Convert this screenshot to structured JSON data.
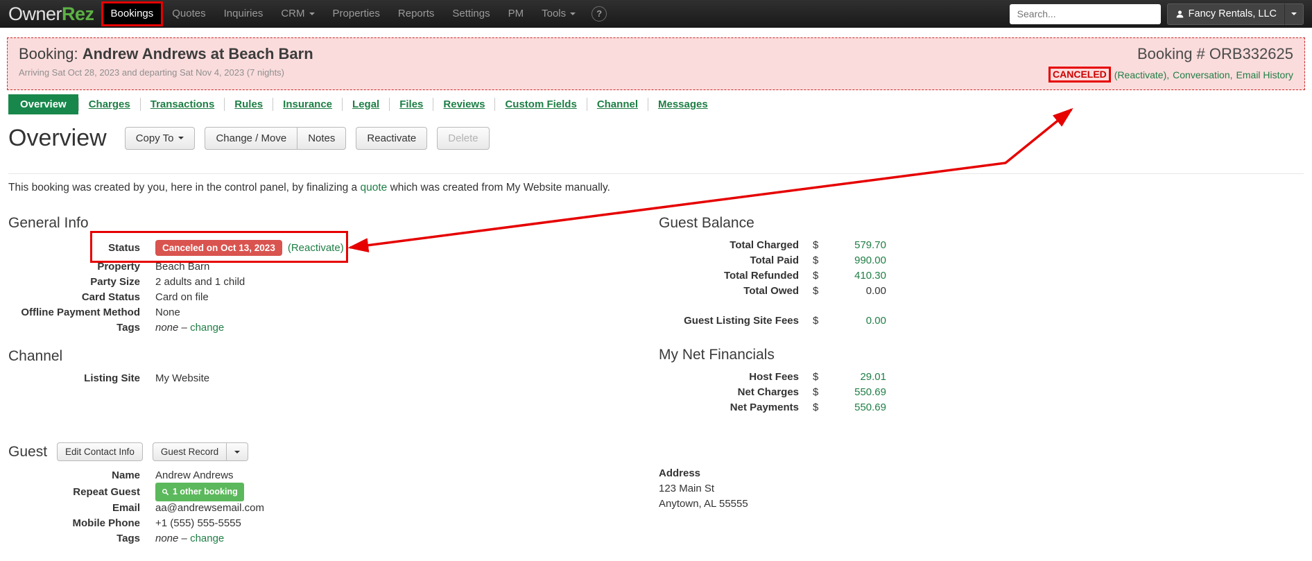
{
  "nav": {
    "logo_owner": "Owner",
    "logo_rez": "Rez",
    "items": [
      {
        "label": "Bookings"
      },
      {
        "label": "Quotes"
      },
      {
        "label": "Inquiries"
      },
      {
        "label": "CRM"
      },
      {
        "label": "Properties"
      },
      {
        "label": "Reports"
      },
      {
        "label": "Settings"
      },
      {
        "label": "PM"
      },
      {
        "label": "Tools"
      }
    ],
    "help_label": "?",
    "search_placeholder": "Search...",
    "account_label": "Fancy Rentals, LLC"
  },
  "banner": {
    "title_prefix": "Booking: ",
    "title_name": "Andrew Andrews at Beach Barn",
    "subtitle": "Arriving Sat Oct 28, 2023 and departing Sat Nov 4, 2023 (7 nights)",
    "booking_number": "Booking # ORB332625",
    "status": "CANCELED",
    "link_reactivate": "(Reactivate),",
    "link_conversation": "Conversation,",
    "link_email_history": "Email History"
  },
  "tabs": [
    "Overview",
    "Charges",
    "Transactions",
    "Rules",
    "Insurance",
    "Legal",
    "Files",
    "Reviews",
    "Custom Fields",
    "Channel",
    "Messages"
  ],
  "overview": {
    "heading": "Overview",
    "buttons": {
      "copy_to": "Copy To",
      "change_move": "Change / Move",
      "notes": "Notes",
      "reactivate": "Reactivate",
      "delete": "Delete"
    },
    "description": {
      "pre": "This booking was created by you, here in the control panel, by finalizing a ",
      "link": "quote",
      "post": " which was created from My Website manually."
    }
  },
  "general_info": {
    "heading": "General Info",
    "status_label": "Status",
    "status_badge": "Canceled on Oct 13, 2023",
    "status_link": "(Reactivate)",
    "rows": [
      {
        "label": "Property",
        "value": "Beach Barn"
      },
      {
        "label": "Party Size",
        "value": "2 adults and 1 child"
      },
      {
        "label": "Card Status",
        "value": "Card on file"
      },
      {
        "label": "Offline Payment Method",
        "value": "None"
      }
    ],
    "tags_label": "Tags",
    "tags_none": "none",
    "tags_sep": "–",
    "tags_change": "change"
  },
  "channel": {
    "heading": "Channel",
    "listing_site_label": "Listing Site",
    "listing_site_value": "My Website"
  },
  "guest": {
    "heading": "Guest",
    "edit_contact_button": "Edit Contact Info",
    "guest_record_button": "Guest Record",
    "name_label": "Name",
    "name": "Andrew Andrews",
    "repeat_label": "Repeat Guest",
    "repeat_badge": "1 other booking",
    "email_label": "Email",
    "email": "aa@andrewsemail.com",
    "phone_label": "Mobile Phone",
    "phone": "+1 (555) 555-5555",
    "tags_label": "Tags",
    "tags_none": "none",
    "tags_sep": "–",
    "tags_change": "change"
  },
  "guest_balance": {
    "heading": "Guest Balance",
    "rows": [
      {
        "label": "Total Charged",
        "currency": "$",
        "value": "579.70"
      },
      {
        "label": "Total Paid",
        "currency": "$",
        "value": "990.00"
      },
      {
        "label": "Total Refunded",
        "currency": "$",
        "value": "410.30"
      },
      {
        "label": "Total Owed",
        "currency": "$",
        "value": "0.00"
      }
    ],
    "fees_row": {
      "label": "Guest Listing Site Fees",
      "currency": "$",
      "value": "0.00"
    }
  },
  "net_financials": {
    "heading": "My Net Financials",
    "rows": [
      {
        "label": "Host Fees",
        "currency": "$",
        "value": "29.01"
      },
      {
        "label": "Net Charges",
        "currency": "$",
        "value": "550.69"
      },
      {
        "label": "Net Payments",
        "currency": "$",
        "value": "550.69"
      }
    ]
  },
  "address": {
    "heading": "Address",
    "line1": "123 Main St",
    "line2": "Anytown, AL 55555"
  },
  "colors": {
    "link_green": "#1e7e45",
    "tab_active_green": "#18874b",
    "status_badge_red": "#d9534f",
    "canceled_red": "#cc0000",
    "annotation_red": "#e60000",
    "banner_pink": "#fbdcdc",
    "repeat_badge_green": "#5cb85c"
  }
}
